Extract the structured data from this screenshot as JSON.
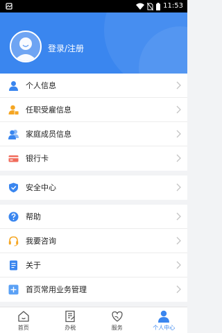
{
  "status_bar": {
    "time": "11:53"
  },
  "header": {
    "login_label": "登录/注册"
  },
  "menu_groups": [
    {
      "items": [
        {
          "label": "个人信息",
          "icon": "person-icon"
        },
        {
          "label": "任职受雇信息",
          "icon": "employment-icon"
        },
        {
          "label": "家庭成员信息",
          "icon": "family-icon"
        },
        {
          "label": "银行卡",
          "icon": "bank-card-icon"
        }
      ]
    },
    {
      "items": [
        {
          "label": "安全中心",
          "icon": "shield-icon"
        }
      ]
    },
    {
      "items": [
        {
          "label": "帮助",
          "icon": "help-icon"
        },
        {
          "label": "我要咨询",
          "icon": "headset-icon"
        },
        {
          "label": "关于",
          "icon": "document-icon"
        },
        {
          "label": "首页常用业务管理",
          "icon": "add-icon"
        }
      ]
    }
  ],
  "tabs": [
    {
      "label": "首页",
      "icon": "home-icon",
      "active": false
    },
    {
      "label": "办税",
      "icon": "tax-document-icon",
      "active": false
    },
    {
      "label": "服务",
      "icon": "service-heart-icon",
      "active": false
    },
    {
      "label": "个人中心",
      "icon": "user-center-icon",
      "active": true
    }
  ],
  "colors": {
    "accent": "#3a86ef",
    "orange": "#f5a623",
    "red": "#f06a5a"
  }
}
